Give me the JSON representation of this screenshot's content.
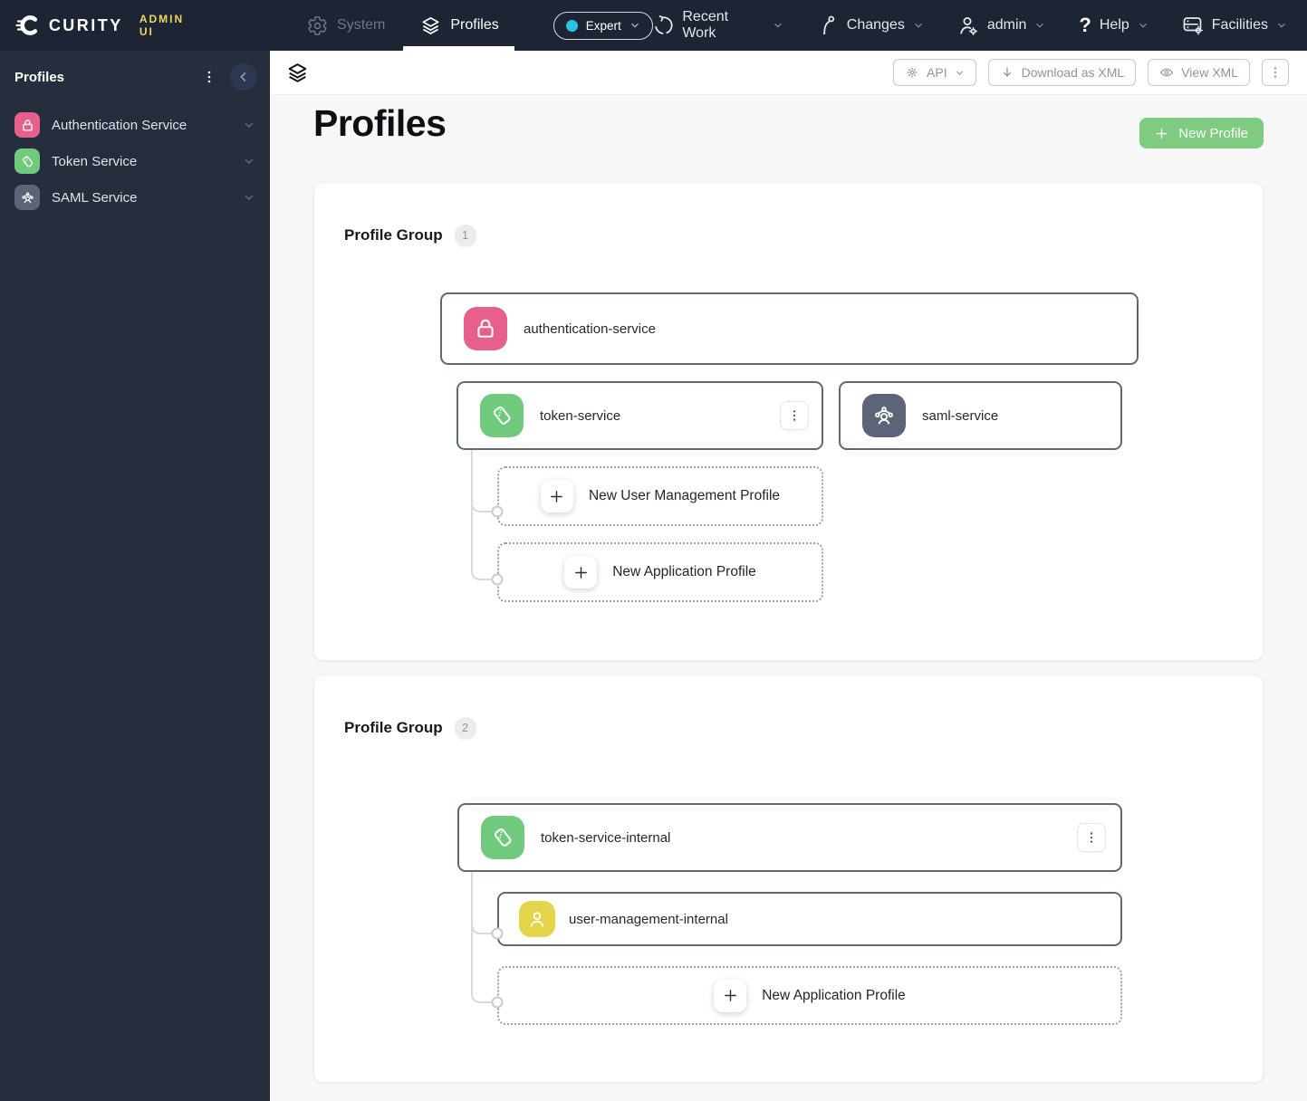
{
  "navbar": {
    "brand": "CURITY",
    "product": "ADMIN UI",
    "tabs": [
      {
        "label": "System"
      },
      {
        "label": "Profiles"
      }
    ],
    "mode_pill": {
      "label": "Expert"
    },
    "menus": [
      {
        "label": "Recent Work"
      },
      {
        "label": "Changes"
      },
      {
        "label": "admin"
      },
      {
        "label": "Help"
      },
      {
        "label": "Facilities"
      }
    ]
  },
  "sidebar": {
    "title": "Profiles",
    "items": [
      {
        "label": "Authentication Service",
        "icon": "lock-icon",
        "color": "#e7608c"
      },
      {
        "label": "Token Service",
        "icon": "ticket-icon",
        "color": "#70ca7d"
      },
      {
        "label": "SAML Service",
        "icon": "group-icon",
        "color": "#5d6478"
      }
    ]
  },
  "toolbar": {
    "api": "API",
    "download_xml": "Download as XML",
    "view_xml": "View XML"
  },
  "page": {
    "title": "Profiles",
    "new_profile": "New Profile"
  },
  "groups": [
    {
      "label": "Profile Group",
      "badge": "1",
      "nodes": {
        "authentication": "authentication-service",
        "token": "token-service",
        "saml": "saml-service",
        "new_user_mgmt": "New User Management Profile",
        "new_app": "New Application Profile"
      }
    },
    {
      "label": "Profile Group",
      "badge": "2",
      "nodes": {
        "token_internal": "token-service-internal",
        "user_mgmt_internal": "user-management-internal",
        "new_app": "New Application Profile"
      }
    }
  ],
  "colors": {
    "authentication_pink": "#e7608c",
    "token_green": "#70ca7d",
    "saml_slate": "#5d6478",
    "user_yellow": "#e3d44a",
    "new_profile_green": "#7ecb81",
    "admin_ui_yellow": "#ecd95c",
    "expert_dot_cyan": "#2bc3e2",
    "navbar_bg": "#1d2433",
    "sidebar_bg": "#262e3e"
  }
}
